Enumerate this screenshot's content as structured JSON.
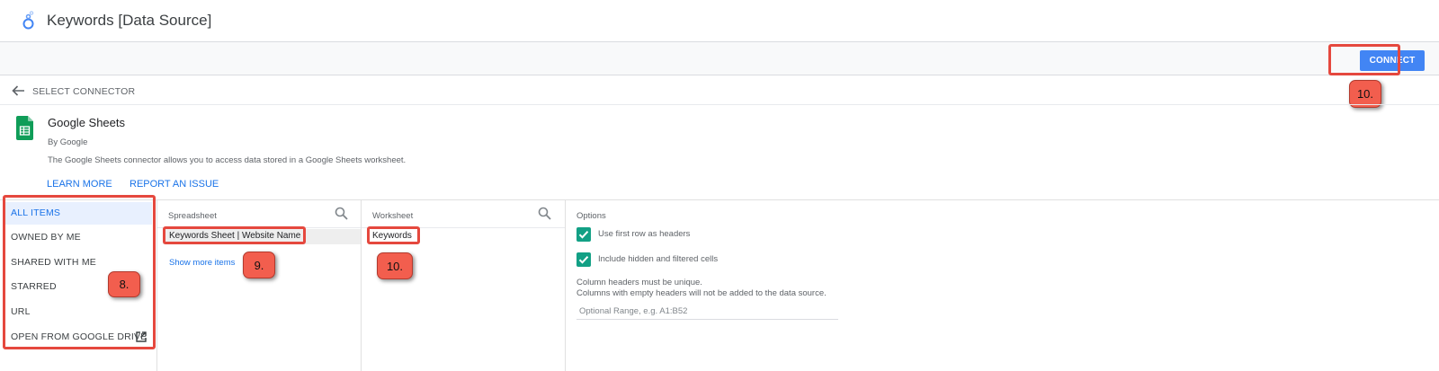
{
  "header": {
    "title": "Keywords [Data Source]",
    "logo_icon": "looker-studio-icon"
  },
  "toolbar": {
    "connect_label": "CONNECT",
    "accent": "#4285f4"
  },
  "nav": {
    "back_label": "SELECT CONNECTOR"
  },
  "connector": {
    "name": "Google Sheets",
    "by": "By Google",
    "description": "The Google Sheets connector allows you to access data stored in a Google Sheets worksheet.",
    "learn_more": "LEARN MORE",
    "report_issue": "REPORT AN ISSUE"
  },
  "sidebar": {
    "items": [
      {
        "label": "ALL ITEMS",
        "active": true
      },
      {
        "label": "OWNED BY ME"
      },
      {
        "label": "SHARED WITH ME"
      },
      {
        "label": "STARRED"
      },
      {
        "label": "URL"
      },
      {
        "label": "OPEN FROM GOOGLE DRIVE"
      }
    ]
  },
  "spreadsheet": {
    "header": "Spreadsheet",
    "selected": "Keywords Sheet | Website Name",
    "show_more": "Show more items"
  },
  "worksheet": {
    "header": "Worksheet",
    "selected": "Keywords"
  },
  "options": {
    "header": "Options",
    "first_row_headers": "Use first row as headers",
    "include_hidden": "Include hidden and filtered cells",
    "note_line1": "Column headers must be unique.",
    "note_line2": "Columns with empty headers will not be added to the data source.",
    "range_placeholder": "Optional Range, e.g. A1:B52",
    "checkbox_color": "#12a085"
  },
  "annotations": {
    "connect_step": "10.",
    "sidebar_step": "8.",
    "spreadsheet_step": "9.",
    "worksheet_step": "10.",
    "color": "#f25e4e"
  }
}
